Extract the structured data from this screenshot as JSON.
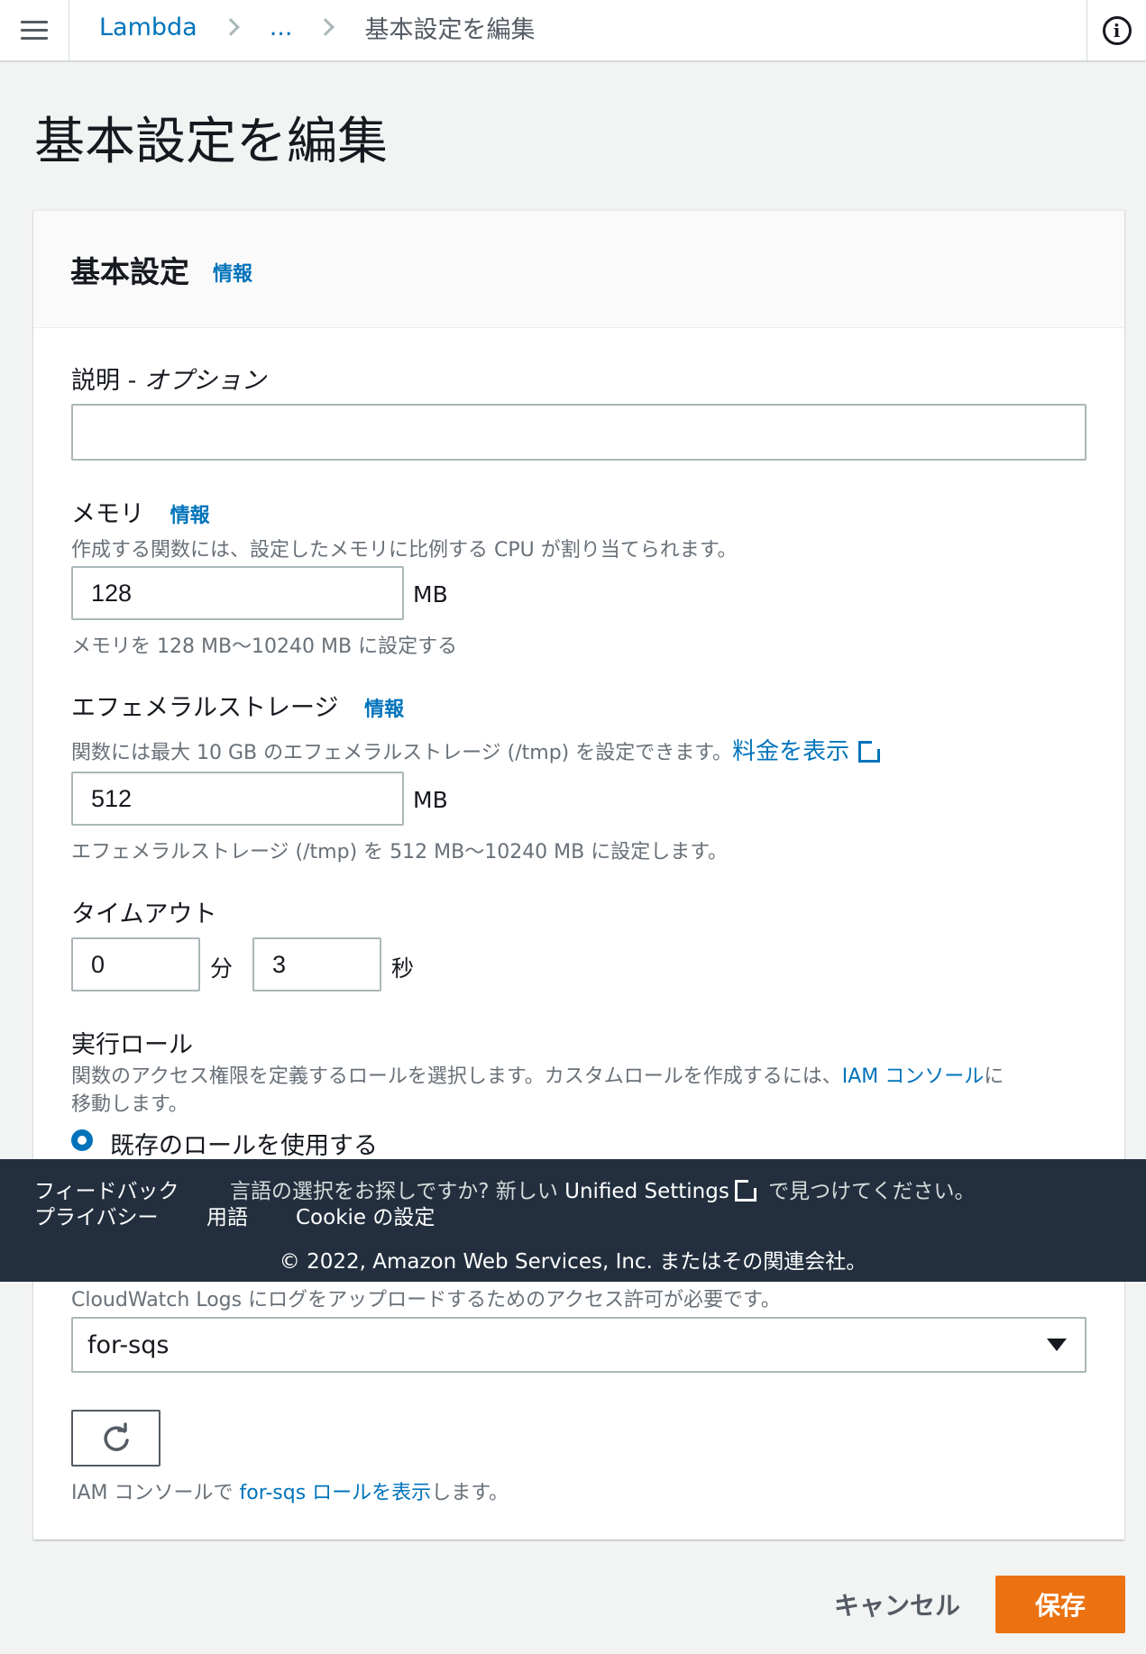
{
  "breadcrumb": {
    "root": "Lambda",
    "ellipsis": "...",
    "current": "基本設定を編集"
  },
  "page": {
    "title": "基本設定を編集"
  },
  "panel": {
    "title": "基本設定",
    "info": "情報"
  },
  "description_field": {
    "label": "説明 - ",
    "label_optional": "オプション",
    "value": ""
  },
  "memory": {
    "label": "メモリ",
    "info": "情報",
    "description": "作成する関数には、設定したメモリに比例する CPU が割り当てられます。",
    "value": "128",
    "unit": "MB",
    "constraint": "メモリを 128 MB〜10240 MB に設定する"
  },
  "ephemeral": {
    "label": "エフェメラルストレージ",
    "info": "情報",
    "description": "関数には最大 10 GB のエフェメラルストレージ (/tmp) を設定できます。",
    "pricing_link": "料金を表示",
    "value": "512",
    "unit": "MB",
    "constraint": "エフェメラルストレージ (/tmp) を 512 MB〜10240 MB に設定します。"
  },
  "timeout": {
    "label": "タイムアウト",
    "minutes": "0",
    "minutes_unit": "分",
    "seconds": "3",
    "seconds_unit": "秒"
  },
  "execution_role": {
    "label": "実行ロール",
    "description_prefix": "関数のアクセス権限を定義するロールを選択します。カスタムロールを作成するには、",
    "iam_link": "IAM コンソール",
    "description_suffix_1": "に",
    "description_suffix_2": "移動します。",
    "radio_label": "既存のロールを使用する",
    "logs_note": "CloudWatch Logs にログをアップロードするためのアクセス許可が必要です。",
    "selected_role": "for-sqs",
    "view_prefix": "IAM コンソールで ",
    "view_link": "for-sqs ロールを表示",
    "view_suffix": "します。"
  },
  "footer": {
    "feedback": "フィードバック",
    "privacy": "プライバシー",
    "terms": "用語",
    "cookie": "Cookie の設定",
    "notice_prefix": "言語の選択をお探しですか? 新しい ",
    "notice_link": "Unified Settings",
    "notice_suffix": " で見つけてください。",
    "copyright": "© 2022, Amazon Web Services, Inc. またはその関連会社。"
  },
  "actions": {
    "cancel": "キャンセル",
    "save": "保存"
  },
  "colors": {
    "link": "#0073bb",
    "primary_button": "#ec7211",
    "footer_bg": "#232f3e"
  }
}
